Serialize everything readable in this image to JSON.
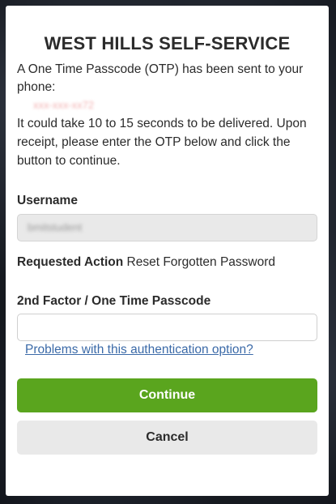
{
  "header": {
    "title": "WEST HILLS SELF-SERVICE"
  },
  "message": {
    "line1": "A One Time Passcode (OTP) has been sent to your phone:",
    "phone_masked": "xxx-xxx-xx72",
    "line2": "It could take 10 to 15 seconds to be delivered. Upon receipt, please enter the OTP below and click the button to continue."
  },
  "username": {
    "label": "Username",
    "value": "bmitstudent"
  },
  "requested_action": {
    "label": "Requested Action",
    "value": "Reset Forgotten Password"
  },
  "otp": {
    "label": "2nd Factor / One Time Passcode",
    "value": "",
    "placeholder": ""
  },
  "links": {
    "problems": "Problems with this authentication option?"
  },
  "buttons": {
    "continue_label": "Continue",
    "cancel_label": "Cancel"
  },
  "colors": {
    "continue_bg": "#5aa51e",
    "cancel_bg": "#e9e9e9",
    "link": "#3b6aa8",
    "masked_phone": "#f2b2b2"
  }
}
